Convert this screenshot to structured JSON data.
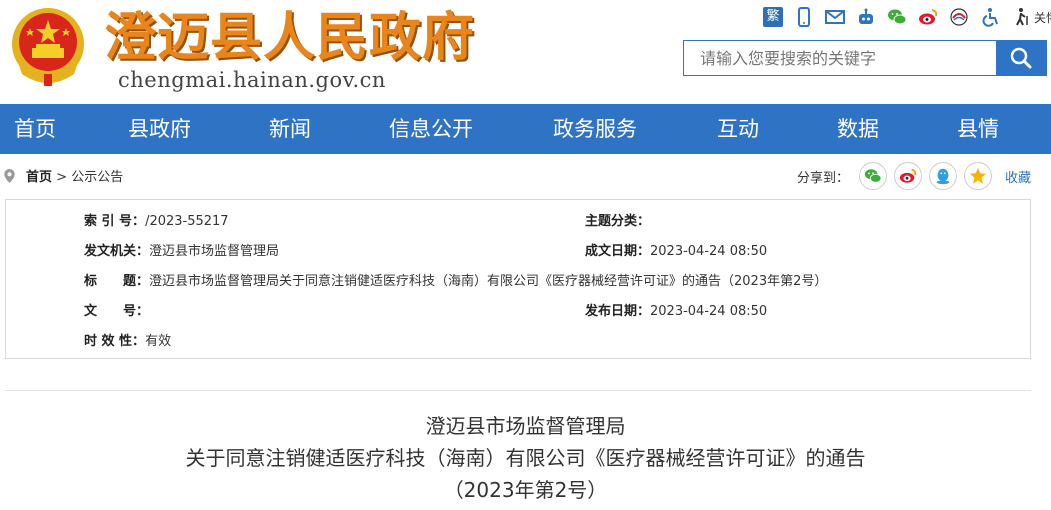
{
  "header": {
    "title": "澄迈县人民政府",
    "domain": "chengmai.hainan.gov.cn",
    "tools": {
      "traditional_label": "繁",
      "elder_mode_label": "关怀版"
    },
    "search": {
      "placeholder": "请输入您要搜索的关键字"
    }
  },
  "nav": {
    "items": [
      "首页",
      "县政府",
      "新闻",
      "信息公开",
      "政务服务",
      "互动",
      "数据",
      "县情"
    ]
  },
  "breadcrumb": {
    "home": "首页",
    "separator": ">",
    "current": "公示公告"
  },
  "share": {
    "label": "分享到：",
    "favorite": "收藏"
  },
  "meta": {
    "index_label": "索 引 号：",
    "index_value": "/2023-55217",
    "topic_label": "主题分类：",
    "topic_value": "",
    "issuer_label": "发文机关：",
    "issuer_value": "澄迈县市场监督管理局",
    "created_label": "成文日期：",
    "created_value": "2023-04-24 08:50",
    "title_label": "标　　题：",
    "title_value": "澄迈县市场监督管理局关于同意注销健适医疗科技（海南）有限公司《医疗器械经营许可证》的通告（2023年第2号）",
    "docno_label": "文　　号：",
    "docno_value": "",
    "published_label": "发布日期：",
    "published_value": "2023-04-24 08:50",
    "validity_label": "时 效 性：",
    "validity_value": "有效"
  },
  "article": {
    "title_line1": "澄迈县市场监督管理局",
    "title_line2": "关于同意注销健适医疗科技（海南）有限公司《医疗器械经营许可证》的通告",
    "title_line3": "（2023年第2号）"
  },
  "colors": {
    "brand_blue": "#2f73c5",
    "title_orange": "#e8861c"
  }
}
